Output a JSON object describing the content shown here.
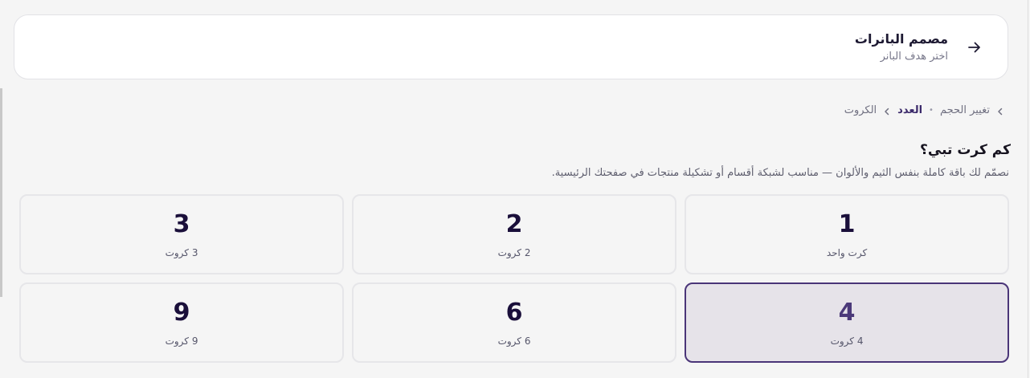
{
  "header": {
    "title": "مصمم البانرات",
    "subtitle": "اختر هدف البانر"
  },
  "breadcrumb": {
    "items": [
      {
        "label": "تغيير الحجم",
        "active": false
      },
      {
        "label": "العدد",
        "active": true
      },
      {
        "label": "الكروت",
        "active": false
      }
    ]
  },
  "section": {
    "heading": "كم كرت تبي؟",
    "description": "نصمّم لك باقة كاملة بنفس الثيم والألوان — مناسب لشبكة أقسام أو تشكيلة منتجات في صفحتك الرئيسية."
  },
  "options": [
    {
      "number": "1",
      "label": "كرت واحد",
      "selected": false
    },
    {
      "number": "2",
      "label": "2 كروت",
      "selected": false
    },
    {
      "number": "3",
      "label": "3 كروت",
      "selected": false
    },
    {
      "number": "4",
      "label": "4 كروت",
      "selected": true
    },
    {
      "number": "6",
      "label": "6 كروت",
      "selected": false
    },
    {
      "number": "9",
      "label": "9 كروت",
      "selected": false
    }
  ],
  "colors": {
    "accent": "#4a3578",
    "selected_bg": "#e6e3e9",
    "number_text": "#1a0f3a"
  },
  "icons": {
    "back": "arrow-right-icon",
    "crumb_chevron": "chevron-left-icon"
  }
}
